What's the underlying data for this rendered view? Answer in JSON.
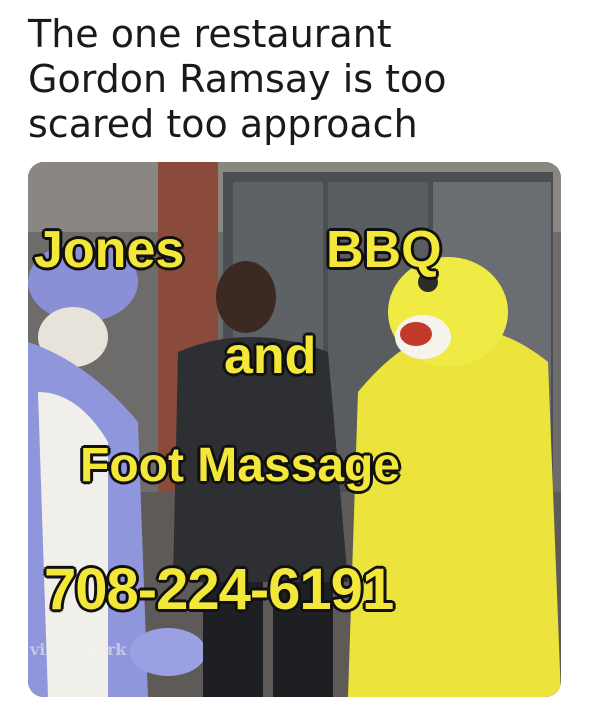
{
  "caption": {
    "line1": "The one restaurant",
    "line2": "Gordon Ramsay is too",
    "line3": "scared too approach"
  },
  "photo": {
    "overlay": {
      "line1_left": "Jones",
      "line1_right": "BBQ",
      "line2": "and",
      "line3": "Foot Massage",
      "line4": "708-224-6191"
    },
    "watermark": "viral shark"
  }
}
